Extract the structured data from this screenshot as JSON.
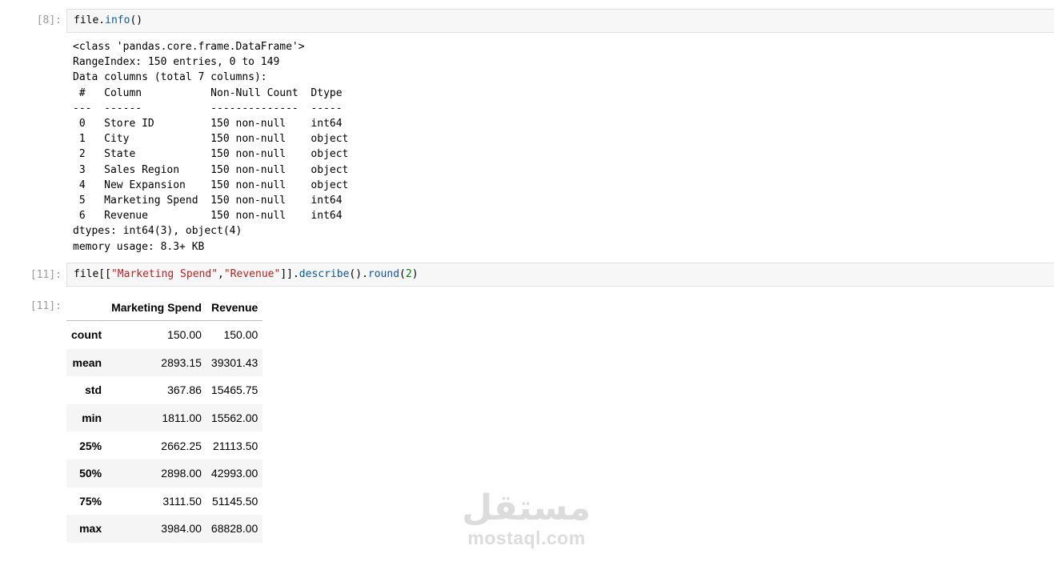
{
  "cells": [
    {
      "prompt": "[8]:",
      "code": {
        "obj": "file.",
        "method": "info",
        "rest": "()"
      },
      "output_lines": [
        "<class 'pandas.core.frame.DataFrame'>",
        "RangeIndex: 150 entries, 0 to 149",
        "Data columns (total 7 columns):",
        " #   Column           Non-Null Count  Dtype ",
        "---  ------           --------------  ----- ",
        " 0   Store ID         150 non-null    int64 ",
        " 1   City             150 non-null    object",
        " 2   State            150 non-null    object",
        " 3   Sales Region     150 non-null    object",
        " 4   New Expansion    150 non-null    object",
        " 5   Marketing Spend  150 non-null    int64 ",
        " 6   Revenue          150 non-null    int64 ",
        "dtypes: int64(3), object(4)",
        "memory usage: 8.3+ KB"
      ]
    },
    {
      "prompt": "[11]:",
      "out_prompt": "[11]:",
      "code": {
        "p1": "file[[",
        "s1": "\"Marketing Spend\"",
        "p2": ",",
        "s2": "\"Revenue\"",
        "p3": "]].",
        "m1": "describe",
        "p4": "().",
        "m2": "round",
        "p5": "(",
        "n1": "2",
        "p6": ")"
      },
      "table": {
        "columns": [
          "",
          "Marketing Spend",
          "Revenue"
        ],
        "rows": [
          [
            "count",
            "150.00",
            "150.00"
          ],
          [
            "mean",
            "2893.15",
            "39301.43"
          ],
          [
            "std",
            "367.86",
            "15465.75"
          ],
          [
            "min",
            "1811.00",
            "15562.00"
          ],
          [
            "25%",
            "2662.25",
            "21113.50"
          ],
          [
            "50%",
            "2898.00",
            "42993.00"
          ],
          [
            "75%",
            "3111.50",
            "51145.50"
          ],
          [
            "max",
            "3984.00",
            "68828.00"
          ]
        ]
      }
    }
  ],
  "watermark": {
    "arabic": "مستقل",
    "latin": "mostaql.com"
  }
}
